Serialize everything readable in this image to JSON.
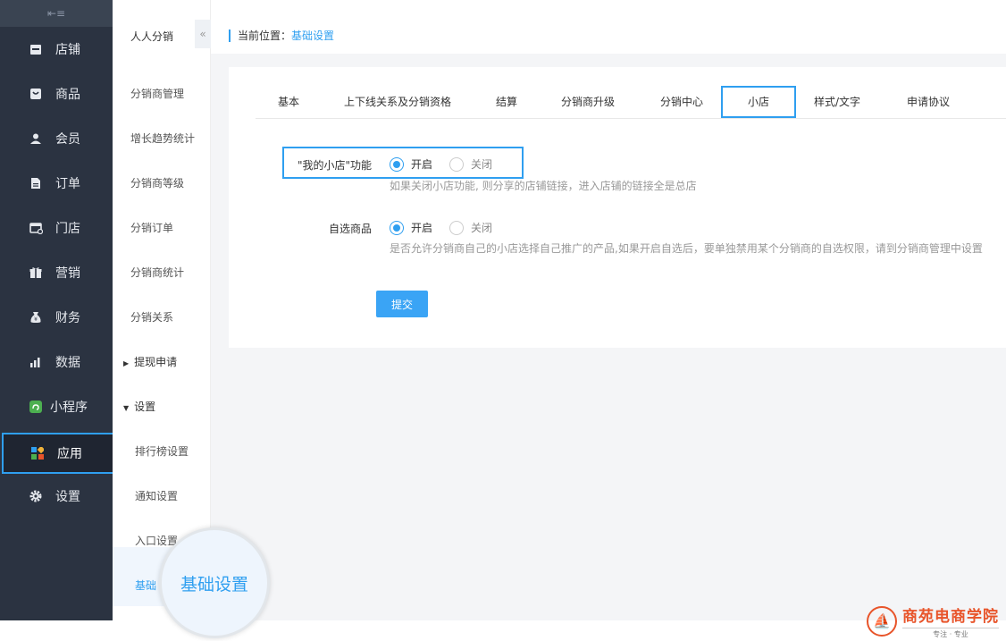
{
  "sidebar": {
    "items": [
      {
        "label": "店铺",
        "icon": "store-icon"
      },
      {
        "label": "商品",
        "icon": "goods-icon"
      },
      {
        "label": "会员",
        "icon": "user-icon"
      },
      {
        "label": "订单",
        "icon": "order-icon"
      },
      {
        "label": "门店",
        "icon": "shop-icon"
      },
      {
        "label": "营销",
        "icon": "gift-icon"
      },
      {
        "label": "财务",
        "icon": "money-bag-icon"
      },
      {
        "label": "数据",
        "icon": "chart-icon"
      },
      {
        "label": "小程序",
        "icon": "mini-program-icon"
      },
      {
        "label": "应用",
        "icon": "apps-icon"
      },
      {
        "label": "设置",
        "icon": "gear-icon"
      }
    ],
    "active": "应用"
  },
  "subnav": {
    "title": "人人分销",
    "items": [
      "分销商管理",
      "增长趋势统计",
      "分销商等级",
      "分销订单",
      "分销商统计",
      "分销关系"
    ],
    "groups": [
      {
        "label": "提现申请",
        "expanded": false
      },
      {
        "label": "设置",
        "expanded": true
      }
    ],
    "children": [
      "排行榜设置",
      "通知设置",
      "入口设置",
      "基础"
    ],
    "magnified": "基础设置"
  },
  "breadcrumb": {
    "prefix": "当前位置：",
    "current": "基础设置"
  },
  "tabs": [
    "基本",
    "上下线关系及分销资格",
    "结算",
    "分销商升级",
    "分销中心",
    "小店",
    "样式/文字",
    "申请协议"
  ],
  "active_tab": "小店",
  "form": {
    "shop": {
      "label": "\"我的小店\"功能",
      "on_label": "开启",
      "off_label": "关闭",
      "hint": "如果关闭小店功能, 则分享的店铺链接，进入店铺的链接全是总店"
    },
    "select": {
      "label": "自选商品",
      "on_label": "开启",
      "off_label": "关闭",
      "hint": "是否允许分销商自己的小店选择自己推广的产品,如果开启自选后，要单独禁用某个分销商的自选权限，请到分销商管理中设置"
    },
    "submit_label": "提交"
  },
  "logo": {
    "name": "商苑电商学院",
    "tagline": "专注 · 专业"
  },
  "colors": {
    "accent": "#2f9ff0",
    "sidebar_bg": "#2b3341",
    "logo": "#e8542a"
  }
}
